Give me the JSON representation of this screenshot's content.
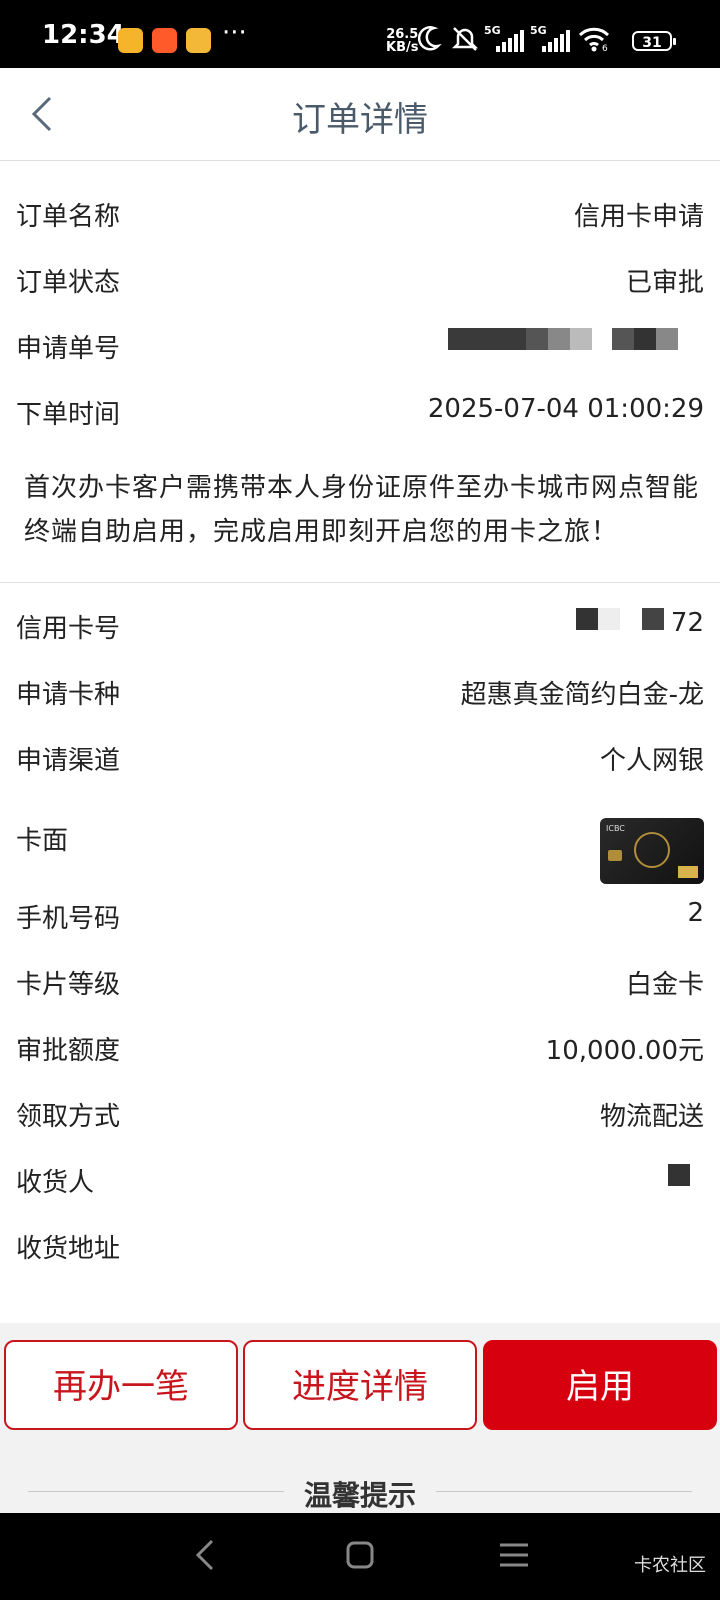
{
  "status_bar": {
    "time": "12:34",
    "more": "···",
    "net_speed_value": "26.5",
    "net_speed_unit": "KB/s",
    "signal1": "5G",
    "signal2": "5G",
    "wifi_sub": "6",
    "battery": "31"
  },
  "header": {
    "title": "订单详情"
  },
  "order": {
    "name_label": "订单名称",
    "name_value": "信用卡申请",
    "status_label": "订单状态",
    "status_value": "已审批",
    "number_label": "申请单号",
    "time_label": "下单时间",
    "time_value": "2025-07-04 01:00:29"
  },
  "notice": "首次办卡客户需携带本人身份证原件至办卡城市网点智能终端自助启用，完成启用即刻开启您的用卡之旅！",
  "card": {
    "number_label": "信用卡号",
    "number_value_tail": "72",
    "type_label": "申请卡种",
    "type_value": "超惠真金简约白金-龙",
    "channel_label": "申请渠道",
    "channel_value": "个人网银",
    "face_label": "卡面",
    "face_text": "ICBC",
    "phone_label": "手机号码",
    "phone_value_tail": "2",
    "level_label": "卡片等级",
    "level_value": "白金卡",
    "limit_label": "审批额度",
    "limit_value": "10,000.00元",
    "pickup_label": "领取方式",
    "pickup_value": "物流配送",
    "receiver_label": "收货人",
    "address_label": "收货地址"
  },
  "actions": {
    "again": "再办一笔",
    "progress": "进度详情",
    "activate": "启用"
  },
  "tips": {
    "title": "温馨提示"
  },
  "watermark": "卡农社区",
  "colors": {
    "accent": "#d6000f",
    "title": "#4a5a6a"
  }
}
